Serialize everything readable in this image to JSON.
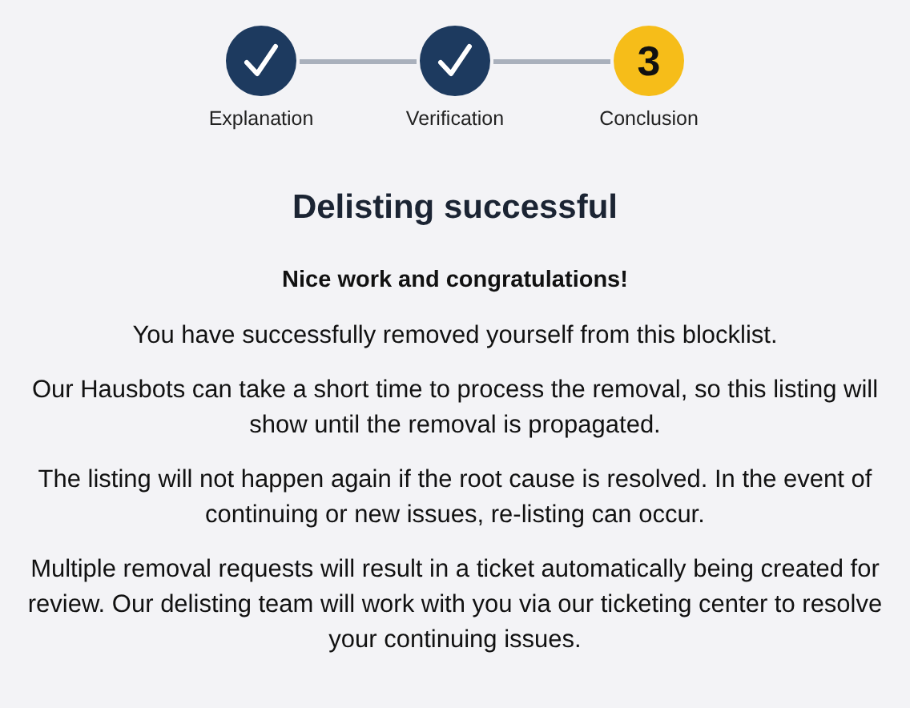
{
  "steps": [
    {
      "label": "Explanation",
      "completed": true
    },
    {
      "label": "Verification",
      "completed": true
    },
    {
      "label": "Conclusion",
      "completed": false,
      "number": "3"
    }
  ],
  "title": "Delisting successful",
  "subtitle": "Nice work and congratulations!",
  "paragraphs": [
    "You have successfully removed yourself from this blocklist.",
    "Our Hausbots can take a short time to process the removal, so this listing will show until the removal is propagated.",
    "The listing will not happen again if the root cause is resolved. In the event of continuing or new issues, re-listing can occur.",
    "Multiple removal requests will result in a ticket automatically being created for review. Our delisting team will work with you via our ticketing center to resolve your continuing issues."
  ]
}
